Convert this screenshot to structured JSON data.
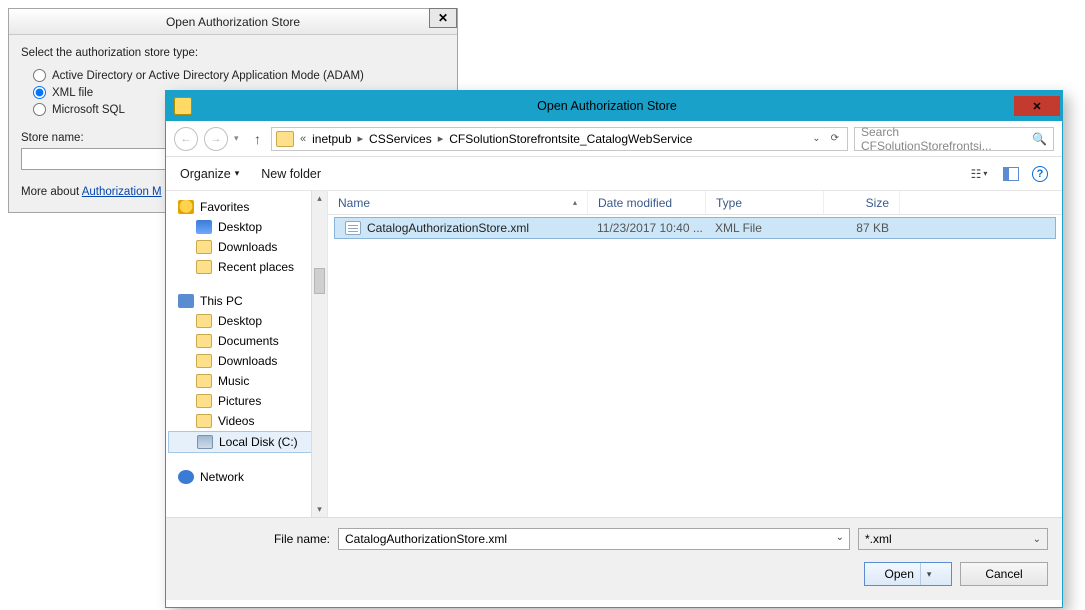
{
  "back_dialog": {
    "title": "Open Authorization Store",
    "close_symbol": "✕",
    "instruction": "Select the authorization store type:",
    "options": {
      "adam": "Active Directory or Active Directory Application Mode (ADAM)",
      "xml": "XML file",
      "mssql": "Microsoft SQL"
    },
    "store_name_label": "Store name:",
    "store_name_value": "",
    "more_about_prefix": "More about ",
    "more_about_link": "Authorization M"
  },
  "file_dialog": {
    "title": "Open Authorization Store",
    "close_symbol": "✕",
    "breadcrumb": {
      "prefix": "«",
      "items": [
        "inetpub",
        "CSServices",
        "CFSolutionStorefrontsite_CatalogWebService"
      ]
    },
    "search_placeholder": "Search CFSolutionStorefrontsi...",
    "toolbar": {
      "organize": "Organize",
      "new_folder": "New folder"
    },
    "tree": {
      "favorites": "Favorites",
      "fav_items": [
        "Desktop",
        "Downloads",
        "Recent places"
      ],
      "this_pc": "This PC",
      "pc_items": [
        "Desktop",
        "Documents",
        "Downloads",
        "Music",
        "Pictures",
        "Videos",
        "Local Disk (C:)"
      ],
      "network": "Network"
    },
    "list": {
      "headers": {
        "name": "Name",
        "date": "Date modified",
        "type": "Type",
        "size": "Size"
      },
      "rows": [
        {
          "name": "CatalogAuthorizationStore.xml",
          "date": "11/23/2017 10:40 ...",
          "type": "XML File",
          "size": "87 KB"
        }
      ]
    },
    "footer": {
      "filename_label": "File name:",
      "filename_value": "CatalogAuthorizationStore.xml",
      "filter": "*.xml",
      "open": "Open",
      "cancel": "Cancel"
    }
  }
}
